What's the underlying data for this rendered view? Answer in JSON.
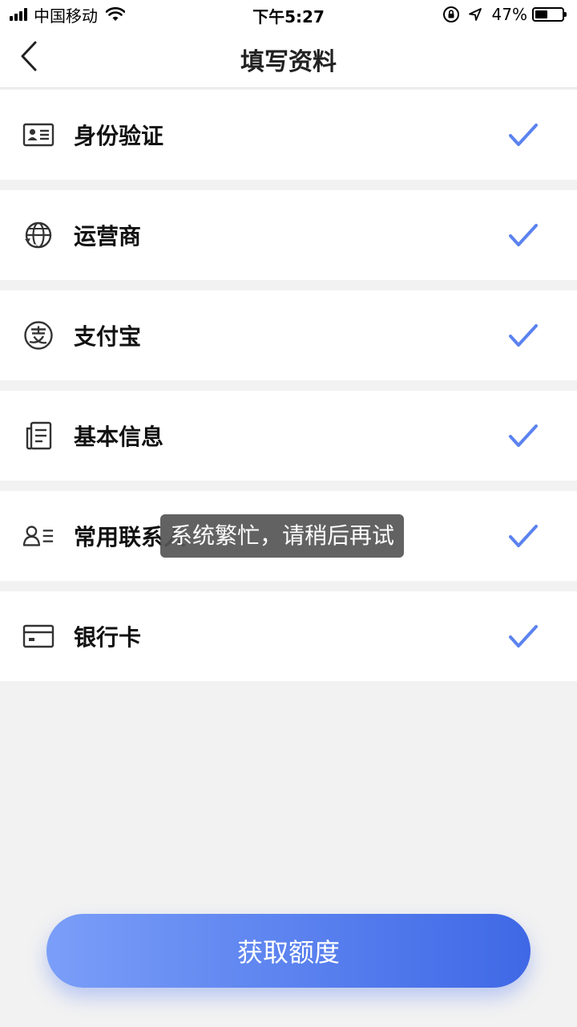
{
  "status_bar": {
    "carrier": "中国移动",
    "time": "下午5:27",
    "battery": "47%",
    "battery_level": 0.47,
    "icons": [
      "signal-icon",
      "wifi-icon",
      "rotation-lock-icon",
      "location-icon",
      "battery-icon"
    ]
  },
  "nav": {
    "title": "填写资料",
    "back_icon": "back-arrow-icon"
  },
  "items": [
    {
      "label": "身份验证",
      "icon": "id-card-icon",
      "completed": true
    },
    {
      "label": "运营商",
      "icon": "carrier-globe-icon",
      "completed": true
    },
    {
      "label": "支付宝",
      "icon": "alipay-icon",
      "completed": true
    },
    {
      "label": "基本信息",
      "icon": "document-icon",
      "completed": true
    },
    {
      "label": "常用联系人",
      "icon": "contacts-icon",
      "completed": true
    },
    {
      "label": "银行卡",
      "icon": "bank-card-icon",
      "completed": true
    }
  ],
  "toast": "系统繁忙，请稍后再试",
  "primary_button": "获取额度",
  "colors": {
    "accent": "#5b82ef",
    "check": "#5b82ef",
    "background": "#f2f2f2"
  }
}
